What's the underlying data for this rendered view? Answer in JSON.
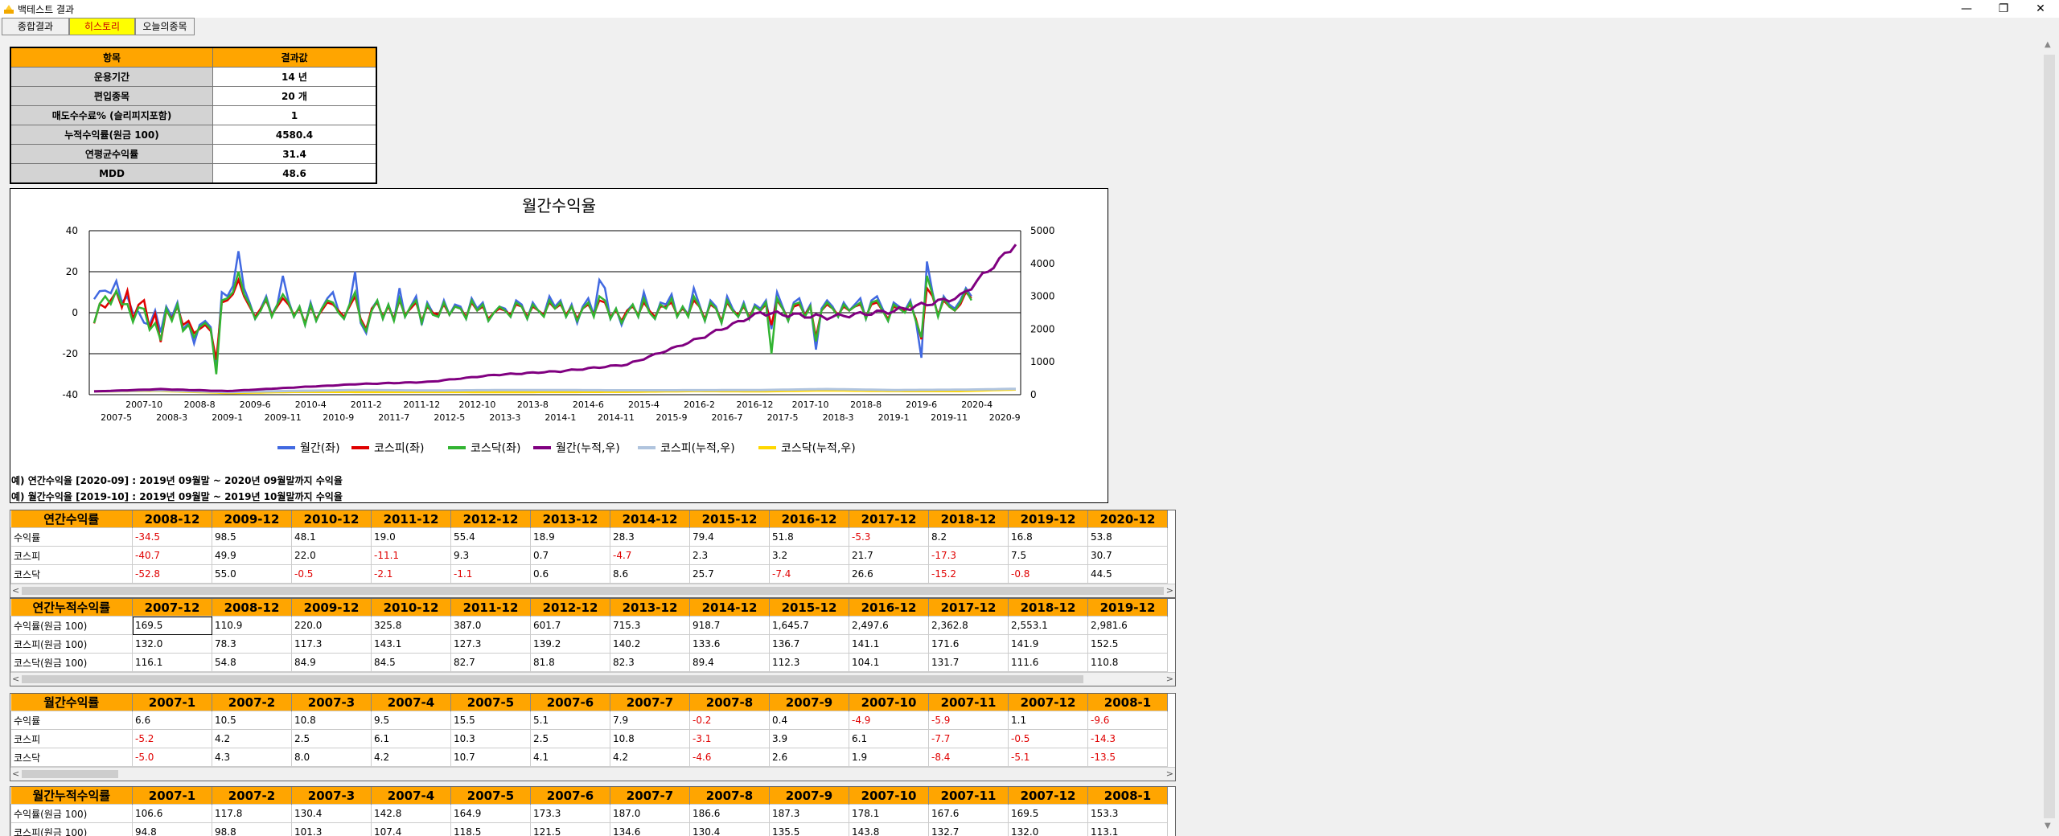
{
  "window": {
    "title": "백테스트 결과",
    "minimize": "—",
    "restore": "❐",
    "close": "✕"
  },
  "tabs": [
    {
      "label": "종합결과"
    },
    {
      "label": "히스토리"
    },
    {
      "label": "오늘의종목"
    }
  ],
  "summary": {
    "headers": [
      "항목",
      "결과값"
    ],
    "rows": [
      {
        "label": "운용기간",
        "value": "14 년"
      },
      {
        "label": "편입종목",
        "value": "20 개"
      },
      {
        "label": "매도수수료% (슬리피지포함)",
        "value": "1"
      },
      {
        "label": "누적수익률(원금 100)",
        "value": "4580.4"
      },
      {
        "label": "연평균수익률",
        "value": "31.4"
      },
      {
        "label": "MDD",
        "value": "48.6"
      }
    ]
  },
  "chart_data": {
    "type": "line",
    "title": "월간수익율",
    "y_left_ticks": [
      "40",
      "20",
      "0",
      "-20",
      "-40"
    ],
    "y_right_ticks": [
      "5000",
      "4000",
      "3000",
      "2000",
      "1000",
      "0"
    ],
    "ylim_left": [
      -40,
      40
    ],
    "ylim_right": [
      0,
      5000
    ],
    "x_ticks_top": [
      "2007-10",
      "2008-8",
      "2009-6",
      "2010-4",
      "2011-2",
      "2011-12",
      "2012-10",
      "2013-8",
      "2014-6",
      "2015-4",
      "2016-2",
      "2016-12",
      "2017-10",
      "2018-8",
      "2019-6",
      "2020-4"
    ],
    "x_ticks_bottom": [
      "2007-5",
      "2008-3",
      "2009-1",
      "2009-11",
      "2010-9",
      "2011-7",
      "2012-5",
      "2013-3",
      "2014-1",
      "2014-11",
      "2015-9",
      "2016-7",
      "2017-5",
      "2018-3",
      "2019-1",
      "2019-11",
      "2020-9"
    ],
    "legend_position": "bottom",
    "grid": true,
    "series": [
      {
        "name": "월간(좌)",
        "color": "#4169e1",
        "axis": "left",
        "values": [
          6.6,
          10.5,
          10.8,
          9.5,
          15.5,
          5.1,
          7.9,
          -0.2,
          0.4,
          -4.9,
          -5.9,
          1.1,
          -9.6,
          3,
          -2,
          5,
          -8,
          -5,
          -15,
          -6,
          -4,
          -7,
          -28,
          10,
          8,
          13,
          30,
          12,
          5,
          -3,
          2,
          8,
          -1,
          4,
          18,
          6,
          -2,
          3,
          -6,
          5,
          -4,
          2,
          7,
          10,
          1,
          -3,
          4,
          20,
          -5,
          -10,
          2,
          6,
          -3,
          4,
          -4,
          12,
          -2,
          3,
          8,
          -6,
          5,
          0,
          -2,
          6,
          -1,
          4,
          3,
          -3,
          7,
          2,
          5,
          -4,
          0,
          3,
          2,
          -2,
          6,
          4,
          -3,
          5,
          1,
          -1,
          8,
          3,
          6,
          -2,
          4,
          -5,
          3,
          7,
          -1,
          16,
          12,
          -3,
          2,
          -6,
          1,
          4,
          -2,
          10,
          1,
          -3,
          5,
          4,
          9,
          -2,
          3,
          -1,
          12,
          4,
          -4,
          6,
          3,
          -5,
          8,
          2,
          -2,
          5,
          -3,
          4,
          2,
          6,
          -8,
          10,
          3,
          -4,
          5,
          7,
          -1,
          4,
          -18,
          2,
          6,
          3,
          -2,
          5,
          1,
          4,
          7,
          -3,
          6,
          8,
          2,
          -4,
          5,
          3,
          1,
          6,
          -4,
          -22,
          25,
          10,
          -2,
          8,
          4,
          2,
          6,
          12,
          8
        ]
      },
      {
        "name": "코스피(좌)",
        "color": "#e00000",
        "axis": "left",
        "values": [
          -5.2,
          4.2,
          2.5,
          6.1,
          10.3,
          2.5,
          10.8,
          -3.1,
          3.9,
          6.1,
          -7.7,
          -0.5,
          -14.3,
          1,
          -3,
          3,
          -6,
          -4,
          -10,
          -8,
          -6,
          -9,
          -23,
          5,
          6,
          9,
          16,
          8,
          3,
          -2,
          2,
          6,
          -1,
          3,
          7,
          4,
          -1,
          2,
          -5,
          3,
          -3,
          1,
          5,
          4,
          1,
          -2,
          3,
          8,
          -3,
          -8,
          2,
          5,
          -2,
          3,
          -3,
          6,
          -1,
          2,
          5,
          -4,
          3,
          0,
          -1,
          4,
          -1,
          3,
          2,
          -2,
          5,
          1,
          3,
          -3,
          0,
          2,
          1,
          -1,
          4,
          3,
          -2,
          3,
          1,
          -1,
          5,
          2,
          4,
          -1,
          3,
          -3,
          2,
          4,
          -1,
          6,
          5,
          -2,
          1,
          -4,
          1,
          3,
          -1,
          5,
          1,
          -2,
          3,
          3,
          5,
          -1,
          2,
          -1,
          6,
          3,
          -3,
          4,
          2,
          -4,
          5,
          1,
          -1,
          3,
          -2,
          3,
          1,
          4,
          -6,
          6,
          2,
          -3,
          3,
          4,
          -1,
          3,
          -12,
          1,
          4,
          2,
          -1,
          3,
          1,
          3,
          4,
          -2,
          4,
          5,
          1,
          -3,
          3,
          2,
          1,
          4,
          -3,
          -13,
          12,
          8,
          -1,
          6,
          3,
          1,
          4,
          10,
          7
        ]
      },
      {
        "name": "코스닥(좌)",
        "color": "#32b432",
        "axis": "left",
        "values": [
          -5,
          4.3,
          8,
          4.2,
          10.7,
          4.1,
          4.2,
          -4.6,
          2.6,
          1.9,
          -8.4,
          -5.1,
          -13.5,
          2,
          -4,
          4,
          -9,
          -6,
          -12,
          -7,
          -5,
          -8,
          -30,
          6,
          7,
          10,
          20,
          9,
          4,
          -3,
          1,
          7,
          -2,
          4,
          9,
          5,
          -2,
          3,
          -6,
          4,
          -4,
          2,
          6,
          5,
          0,
          -3,
          4,
          10,
          -4,
          -9,
          1,
          6,
          -3,
          4,
          -4,
          7,
          -2,
          3,
          6,
          -5,
          4,
          -1,
          -2,
          5,
          -1,
          3,
          2,
          -3,
          6,
          1,
          4,
          -4,
          0,
          3,
          1,
          -2,
          5,
          3,
          -3,
          4,
          1,
          -2,
          6,
          2,
          5,
          -2,
          3,
          -4,
          2,
          5,
          -2,
          8,
          6,
          -3,
          2,
          -5,
          0,
          4,
          -2,
          7,
          0,
          -3,
          4,
          2,
          7,
          -2,
          3,
          -2,
          8,
          3,
          -4,
          5,
          2,
          -5,
          6,
          1,
          -2,
          4,
          -3,
          3,
          1,
          5,
          -20,
          7,
          2,
          -4,
          4,
          5,
          -2,
          3,
          -14,
          1,
          5,
          2,
          -2,
          4,
          1,
          3,
          5,
          -3,
          5,
          6,
          1,
          -4,
          4,
          2,
          0,
          5,
          -4,
          -12,
          18,
          9,
          -2,
          7,
          3,
          1,
          5,
          11,
          6
        ]
      }
    ],
    "cumulative_series": [
      {
        "name": "월간(누적,우)",
        "color": "#800080",
        "axis": "right",
        "values_key_points": [
          [
            0,
            100
          ],
          [
            12,
            169.5
          ],
          [
            24,
            110.9
          ],
          [
            36,
            220
          ],
          [
            48,
            325.8
          ],
          [
            60,
            387
          ],
          [
            72,
            601.7
          ],
          [
            84,
            715.3
          ],
          [
            96,
            918.7
          ],
          [
            108,
            1645.7
          ],
          [
            120,
            2497.6
          ],
          [
            132,
            2362.8
          ],
          [
            144,
            2553.1
          ],
          [
            156,
            2981.6
          ],
          [
            166,
            4580.4
          ]
        ]
      },
      {
        "name": "코스피(누적,우)",
        "color": "#b0c4de",
        "axis": "right",
        "values_key_points": [
          [
            0,
            100
          ],
          [
            12,
            132
          ],
          [
            24,
            78.3
          ],
          [
            36,
            117.3
          ],
          [
            48,
            143.1
          ],
          [
            60,
            127.3
          ],
          [
            72,
            139.2
          ],
          [
            84,
            140.2
          ],
          [
            96,
            133.6
          ],
          [
            108,
            136.7
          ],
          [
            120,
            141.1
          ],
          [
            132,
            171.6
          ],
          [
            144,
            141.9
          ],
          [
            156,
            152.5
          ],
          [
            166,
            178
          ]
        ]
      },
      {
        "name": "코스닥(누적,우)",
        "color": "#ffd700",
        "axis": "right",
        "values_key_points": [
          [
            0,
            100
          ],
          [
            12,
            116.1
          ],
          [
            24,
            54.8
          ],
          [
            36,
            84.9
          ],
          [
            48,
            84.5
          ],
          [
            60,
            82.7
          ],
          [
            72,
            81.8
          ],
          [
            84,
            82.3
          ],
          [
            96,
            89.4
          ],
          [
            108,
            112.3
          ],
          [
            120,
            104.1
          ],
          [
            132,
            131.7
          ],
          [
            144,
            111.6
          ],
          [
            156,
            110.8
          ],
          [
            166,
            160
          ]
        ]
      }
    ]
  },
  "notes": [
    "예) 연간수익율 [2020-09] : 2019년 09월말 ~ 2020년 09월말까지 수익율",
    "예) 월간수익율 [2019-10] : 2019년 09월말 ~ 2019년 10월말까지 수익율"
  ],
  "grids": [
    {
      "header": "연간수익률",
      "columns": [
        "2008-12",
        "2009-12",
        "2010-12",
        "2011-12",
        "2012-12",
        "2013-12",
        "2014-12",
        "2015-12",
        "2016-12",
        "2017-12",
        "2018-12",
        "2019-12",
        "2020-12"
      ],
      "rows": [
        {
          "label": "수익률",
          "cells": [
            "-34.5",
            "98.5",
            "48.1",
            "19.0",
            "55.4",
            "18.9",
            "28.3",
            "79.4",
            "51.8",
            "-5.3",
            "8.2",
            "16.8",
            "53.8"
          ]
        },
        {
          "label": "코스피",
          "cells": [
            "-40.7",
            "49.9",
            "22.0",
            "-11.1",
            "9.3",
            "0.7",
            "-4.7",
            "2.3",
            "3.2",
            "21.7",
            "-17.3",
            "7.5",
            "30.7"
          ]
        },
        {
          "label": "코스닥",
          "cells": [
            "-52.8",
            "55.0",
            "-0.5",
            "-2.1",
            "-1.1",
            "0.6",
            "8.6",
            "25.7",
            "-7.4",
            "26.6",
            "-15.2",
            "-0.8",
            "44.5"
          ]
        }
      ]
    },
    {
      "header": "연간누적수익률",
      "columns": [
        "2007-12",
        "2008-12",
        "2009-12",
        "2010-12",
        "2011-12",
        "2012-12",
        "2013-12",
        "2014-12",
        "2015-12",
        "2016-12",
        "2017-12",
        "2018-12",
        "2019-12"
      ],
      "rows": [
        {
          "label": "수익률(원금 100)",
          "cells": [
            "169.5",
            "110.9",
            "220.0",
            "325.8",
            "387.0",
            "601.7",
            "715.3",
            "918.7",
            "1,645.7",
            "2,497.6",
            "2,362.8",
            "2,553.1",
            "2,981.6"
          ]
        },
        {
          "label": "코스피(원금 100)",
          "cells": [
            "132.0",
            "78.3",
            "117.3",
            "143.1",
            "127.3",
            "139.2",
            "140.2",
            "133.6",
            "136.7",
            "141.1",
            "171.6",
            "141.9",
            "152.5"
          ]
        },
        {
          "label": "코스닥(원금 100)",
          "cells": [
            "116.1",
            "54.8",
            "84.9",
            "84.5",
            "82.7",
            "81.8",
            "82.3",
            "89.4",
            "112.3",
            "104.1",
            "131.7",
            "111.6",
            "110.8"
          ]
        }
      ]
    },
    {
      "header": "월간수익률",
      "columns": [
        "2007-1",
        "2007-2",
        "2007-3",
        "2007-4",
        "2007-5",
        "2007-6",
        "2007-7",
        "2007-8",
        "2007-9",
        "2007-10",
        "2007-11",
        "2007-12",
        "2008-1"
      ],
      "rows": [
        {
          "label": "수익률",
          "cells": [
            "6.6",
            "10.5",
            "10.8",
            "9.5",
            "15.5",
            "5.1",
            "7.9",
            "-0.2",
            "0.4",
            "-4.9",
            "-5.9",
            "1.1",
            "-9.6"
          ]
        },
        {
          "label": "코스피",
          "cells": [
            "-5.2",
            "4.2",
            "2.5",
            "6.1",
            "10.3",
            "2.5",
            "10.8",
            "-3.1",
            "3.9",
            "6.1",
            "-7.7",
            "-0.5",
            "-14.3"
          ]
        },
        {
          "label": "코스닥",
          "cells": [
            "-5.0",
            "4.3",
            "8.0",
            "4.2",
            "10.7",
            "4.1",
            "4.2",
            "-4.6",
            "2.6",
            "1.9",
            "-8.4",
            "-5.1",
            "-13.5"
          ]
        }
      ]
    },
    {
      "header": "월간누적수익률",
      "columns": [
        "2007-1",
        "2007-2",
        "2007-3",
        "2007-4",
        "2007-5",
        "2007-6",
        "2007-7",
        "2007-8",
        "2007-9",
        "2007-10",
        "2007-11",
        "2007-12",
        "2008-1"
      ],
      "rows": [
        {
          "label": "수익률(원금 100)",
          "cells": [
            "106.6",
            "117.8",
            "130.4",
            "142.8",
            "164.9",
            "173.3",
            "187.0",
            "186.6",
            "187.3",
            "178.1",
            "167.6",
            "169.5",
            "153.3"
          ]
        },
        {
          "label": "코스피(원금 100)",
          "cells": [
            "94.8",
            "98.8",
            "101.3",
            "107.4",
            "118.5",
            "121.5",
            "134.6",
            "130.4",
            "135.5",
            "143.8",
            "132.7",
            "132.0",
            "113.1"
          ]
        }
      ]
    }
  ]
}
